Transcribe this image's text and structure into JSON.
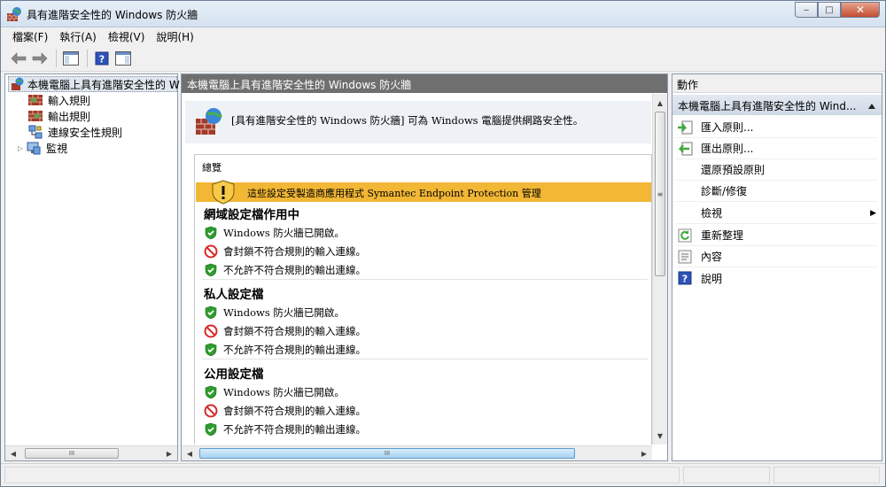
{
  "window": {
    "title": "具有進階安全性的 Windows 防火牆",
    "minimize_label": "‒",
    "maximize_label": "□",
    "close_label": "✕"
  },
  "menu": [
    "檔案(F)",
    "執行(A)",
    "檢視(V)",
    "說明(H)"
  ],
  "tree": {
    "root": "本機電腦上具有進階安全性的 W",
    "items": [
      "輸入規則",
      "輸出規則",
      "連線安全性規則",
      "監視"
    ],
    "expand_glyph": "▷"
  },
  "middle": {
    "header": "本機電腦上具有進階安全性的 Windows 防火牆",
    "intro": "[具有進階安全性的 Windows 防火牆] 可為 Windows 電腦提供網路安全性。",
    "overview_title": "總覽",
    "banner": "這些設定受製造商應用程式 Symantec Endpoint Protection 管理",
    "profiles": [
      {
        "title": "網域設定檔作用中",
        "rows": [
          {
            "icon": "check",
            "text": "Windows 防火牆已開啟。"
          },
          {
            "icon": "block",
            "text": "會封鎖不符合規則的輸入連線。"
          },
          {
            "icon": "check",
            "text": "不允許不符合規則的輸出連線。"
          }
        ]
      },
      {
        "title": "私人設定檔",
        "rows": [
          {
            "icon": "check",
            "text": "Windows 防火牆已開啟。"
          },
          {
            "icon": "block",
            "text": "會封鎖不符合規則的輸入連線。"
          },
          {
            "icon": "check",
            "text": "不允許不符合規則的輸出連線。"
          }
        ]
      },
      {
        "title": "公用設定檔",
        "rows": [
          {
            "icon": "check",
            "text": "Windows 防火牆已開啟。"
          },
          {
            "icon": "block",
            "text": "會封鎖不符合規則的輸入連線。"
          },
          {
            "icon": "check",
            "text": "不允許不符合規則的輸出連線。"
          }
        ]
      }
    ]
  },
  "actions": {
    "header": "動作",
    "sub": "本機電腦上具有進階安全性的 Wind...",
    "items": [
      "匯入原則...",
      "匯出原則...",
      "還原預設原則",
      "診斷/修復",
      "檢視",
      "重新整理",
      "內容",
      "說明"
    ],
    "submenu_arrow": "▶"
  },
  "scroll": {
    "thumb_grip": "III",
    "vertical_thumb_grip": "≡",
    "left_arrow": "◀",
    "right_arrow": "▶",
    "up_arrow": "▲",
    "down_arrow": "▼"
  },
  "colors": {
    "banner": "#f2b735",
    "mid_header": "#6f6f6f",
    "check_green": "#2e9d2e",
    "block_red": "#d62b2b"
  }
}
